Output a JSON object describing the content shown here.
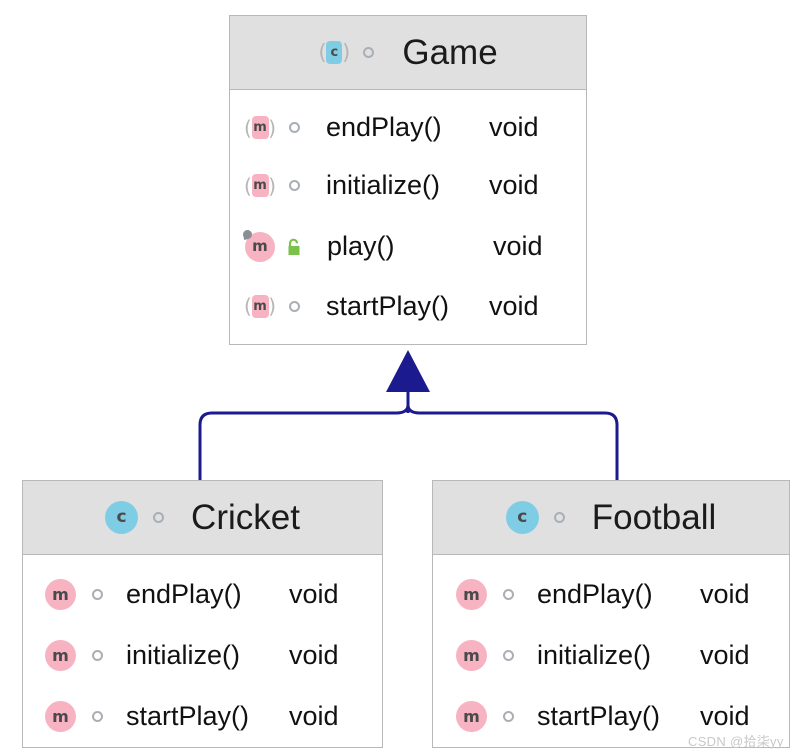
{
  "diagram": {
    "title": "UML class diagram",
    "relationship": "generalization",
    "arrow_color": "#1b1b8f",
    "header_bg": "#e0e0e0",
    "body_bg": "#ffffff",
    "border_color": "#b8b8b8",
    "class_icon_color": "#7fcde4",
    "method_icon_color": "#f7b3c2",
    "padlock_color": "#7ac24a"
  },
  "classes": [
    {
      "id": "game",
      "name": "Game",
      "icon": "abstract-class-icon",
      "icon_letter": "c",
      "abstract": true,
      "visibility_icon": "package-private-circle-icon",
      "members": [
        {
          "name": "endPlay()",
          "type": "void",
          "icon": "abstract-method-icon",
          "icon_letter": "m",
          "abstract": true,
          "visibility_icon": "package-private-circle-icon",
          "override": false
        },
        {
          "name": "initialize()",
          "type": "void",
          "icon": "abstract-method-icon",
          "icon_letter": "m",
          "abstract": true,
          "visibility_icon": "package-private-circle-icon",
          "override": false
        },
        {
          "name": "play()",
          "type": "void",
          "icon": "method-icon",
          "icon_letter": "m",
          "abstract": false,
          "visibility_icon": "public-open-padlock-icon",
          "override": true
        },
        {
          "name": "startPlay()",
          "type": "void",
          "icon": "abstract-method-icon",
          "icon_letter": "m",
          "abstract": true,
          "visibility_icon": "package-private-circle-icon",
          "override": false
        }
      ]
    },
    {
      "id": "cricket",
      "name": "Cricket",
      "icon": "class-icon",
      "icon_letter": "c",
      "abstract": false,
      "visibility_icon": "package-private-circle-icon",
      "members": [
        {
          "name": "endPlay()",
          "type": "void",
          "icon": "method-icon",
          "icon_letter": "m",
          "abstract": false,
          "visibility_icon": "package-private-circle-icon",
          "override": false
        },
        {
          "name": "initialize()",
          "type": "void",
          "icon": "method-icon",
          "icon_letter": "m",
          "abstract": false,
          "visibility_icon": "package-private-circle-icon",
          "override": false
        },
        {
          "name": "startPlay()",
          "type": "void",
          "icon": "method-icon",
          "icon_letter": "m",
          "abstract": false,
          "visibility_icon": "package-private-circle-icon",
          "override": false
        }
      ]
    },
    {
      "id": "football",
      "name": "Football",
      "icon": "class-icon",
      "icon_letter": "c",
      "abstract": false,
      "visibility_icon": "package-private-circle-icon",
      "members": [
        {
          "name": "endPlay()",
          "type": "void",
          "icon": "method-icon",
          "icon_letter": "m",
          "abstract": false,
          "visibility_icon": "package-private-circle-icon",
          "override": false
        },
        {
          "name": "initialize()",
          "type": "void",
          "icon": "method-icon",
          "icon_letter": "m",
          "abstract": false,
          "visibility_icon": "package-private-circle-icon",
          "override": false
        },
        {
          "name": "startPlay()",
          "type": "void",
          "icon": "method-icon",
          "icon_letter": "m",
          "abstract": false,
          "visibility_icon": "package-private-circle-icon",
          "override": false
        }
      ]
    }
  ],
  "watermark": {
    "text": "CSDN @拾柒yy"
  }
}
